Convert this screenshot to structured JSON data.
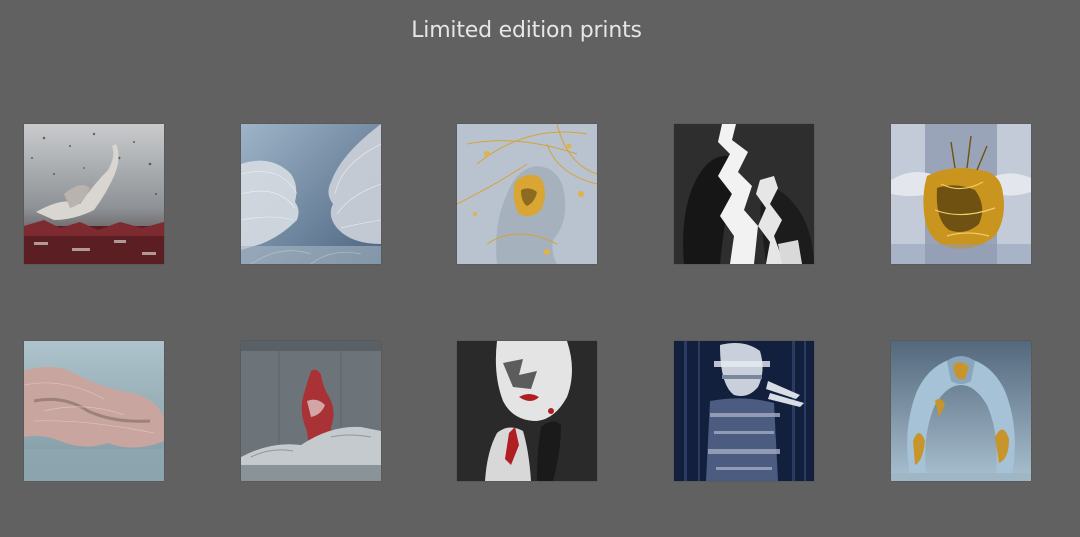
{
  "page": {
    "title": "Limited edition prints",
    "background": "#616161"
  },
  "gallery": {
    "items": [
      {
        "icon": "drowning-figure-artwork",
        "palette": [
          "#a9adb1",
          "#5a2025",
          "#d8dadc"
        ]
      },
      {
        "icon": "kissing-faces-wire-artwork",
        "palette": [
          "#6f8ba3",
          "#d6dbe2",
          "#4c6580"
        ]
      },
      {
        "icon": "golden-head-artwork",
        "palette": [
          "#b9c3cf",
          "#d9a533",
          "#8c6a22"
        ]
      },
      {
        "icon": "fractured-faces-artwork",
        "palette": [
          "#2e2e2e",
          "#f2f2f2",
          "#141414"
        ]
      },
      {
        "icon": "gold-cloth-figure-artwork",
        "palette": [
          "#c3cad8",
          "#c9951f",
          "#6f5212"
        ]
      },
      {
        "icon": "wrapped-reclining-figure-artwork",
        "palette": [
          "#9bb3bc",
          "#c9a59f",
          "#7e6a66"
        ]
      },
      {
        "icon": "red-figure-concrete-artwork",
        "palette": [
          "#6c7479",
          "#a83236",
          "#c4cacd"
        ]
      },
      {
        "icon": "red-lips-portrait-artwork",
        "palette": [
          "#2a2a2a",
          "#e4e4e4",
          "#b01e22"
        ]
      },
      {
        "icon": "glitch-portrait-artwork",
        "palette": [
          "#12203d",
          "#c9d0dc",
          "#4b5c80"
        ]
      },
      {
        "icon": "gold-embrace-artwork",
        "palette": [
          "#6d8499",
          "#a6c2d6",
          "#c8952c"
        ]
      }
    ]
  }
}
